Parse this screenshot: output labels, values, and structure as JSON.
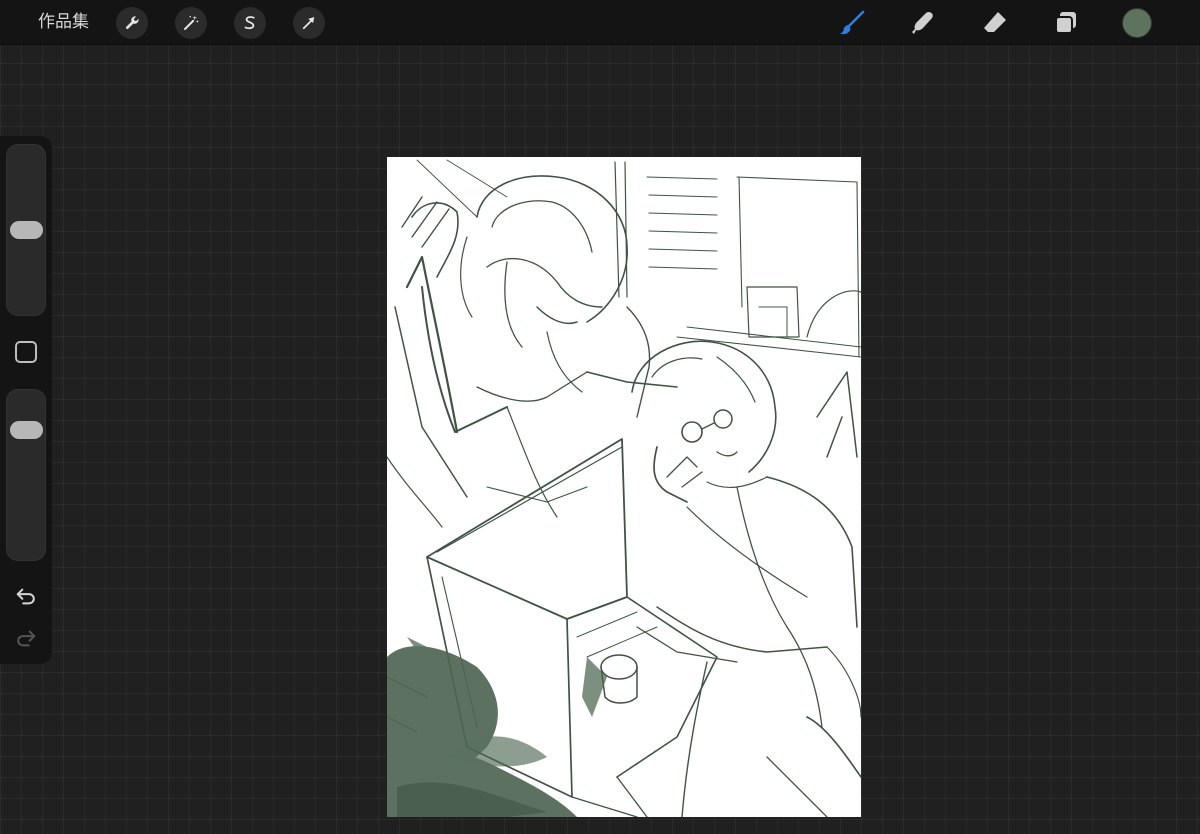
{
  "toolbar": {
    "gallery_label": "作品集",
    "left_tools": [
      {
        "name": "actions-wrench-icon"
      },
      {
        "name": "adjustments-wand-icon"
      },
      {
        "name": "selection-s-icon"
      },
      {
        "name": "transform-arrow-icon"
      }
    ],
    "right_tools": [
      {
        "name": "brush-icon",
        "active": true
      },
      {
        "name": "smudge-icon",
        "active": false
      },
      {
        "name": "eraser-icon",
        "active": false
      },
      {
        "name": "layers-icon",
        "active": false
      }
    ]
  },
  "colors": {
    "active_tool": "#2f7de1",
    "inactive_tool": "#d0d0d0",
    "current_color": "#5d7360",
    "sketch_stroke": "#3f5444"
  },
  "sidebar": {
    "brush_size_level": 0.5,
    "opacity_level": 0.81
  }
}
